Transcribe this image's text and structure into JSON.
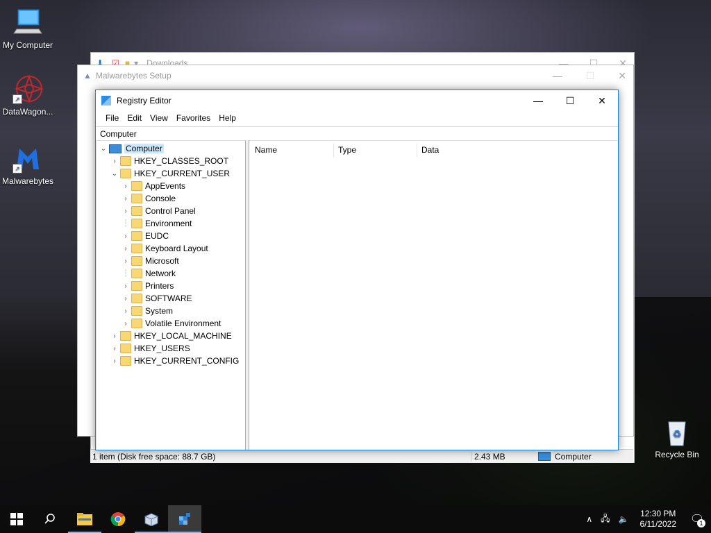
{
  "desktop": {
    "icons": [
      {
        "label": "My Computer",
        "icon": "computer-icon"
      },
      {
        "label": "DataWagon...",
        "icon": "datawagon-icon"
      },
      {
        "label": "Malwarebytes",
        "icon": "malwarebytes-icon"
      },
      {
        "label": "Recycle Bin",
        "icon": "recycle-bin-icon"
      }
    ]
  },
  "explorer_window": {
    "title": "Downloads",
    "status_left": "1 item (Disk free space: 88.7 GB)",
    "status_size": "2.43 MB",
    "status_location": "Computer"
  },
  "malwarebytes_window": {
    "title": "Malwarebytes Setup"
  },
  "regedit": {
    "title": "Registry Editor",
    "menu": [
      "File",
      "Edit",
      "View",
      "Favorites",
      "Help"
    ],
    "address": "Computer",
    "tree": {
      "root": "Computer",
      "hives": [
        {
          "label": "HKEY_CLASSES_ROOT"
        },
        {
          "label": "HKEY_CURRENT_USER"
        },
        {
          "label": "HKEY_LOCAL_MACHINE"
        },
        {
          "label": "HKEY_USERS"
        },
        {
          "label": "HKEY_CURRENT_CONFIG"
        }
      ],
      "hkcu_children": [
        {
          "label": "AppEvents"
        },
        {
          "label": "Console"
        },
        {
          "label": "Control Panel"
        },
        {
          "label": "Environment"
        },
        {
          "label": "EUDC"
        },
        {
          "label": "Keyboard Layout"
        },
        {
          "label": "Microsoft"
        },
        {
          "label": "Network"
        },
        {
          "label": "Printers"
        },
        {
          "label": "SOFTWARE"
        },
        {
          "label": "System"
        },
        {
          "label": "Volatile Environment"
        }
      ]
    },
    "columns": [
      "Name",
      "Type",
      "Data"
    ]
  },
  "taskbar": {
    "time": "12:30 PM",
    "date": "6/11/2022",
    "notification_count": "1"
  }
}
